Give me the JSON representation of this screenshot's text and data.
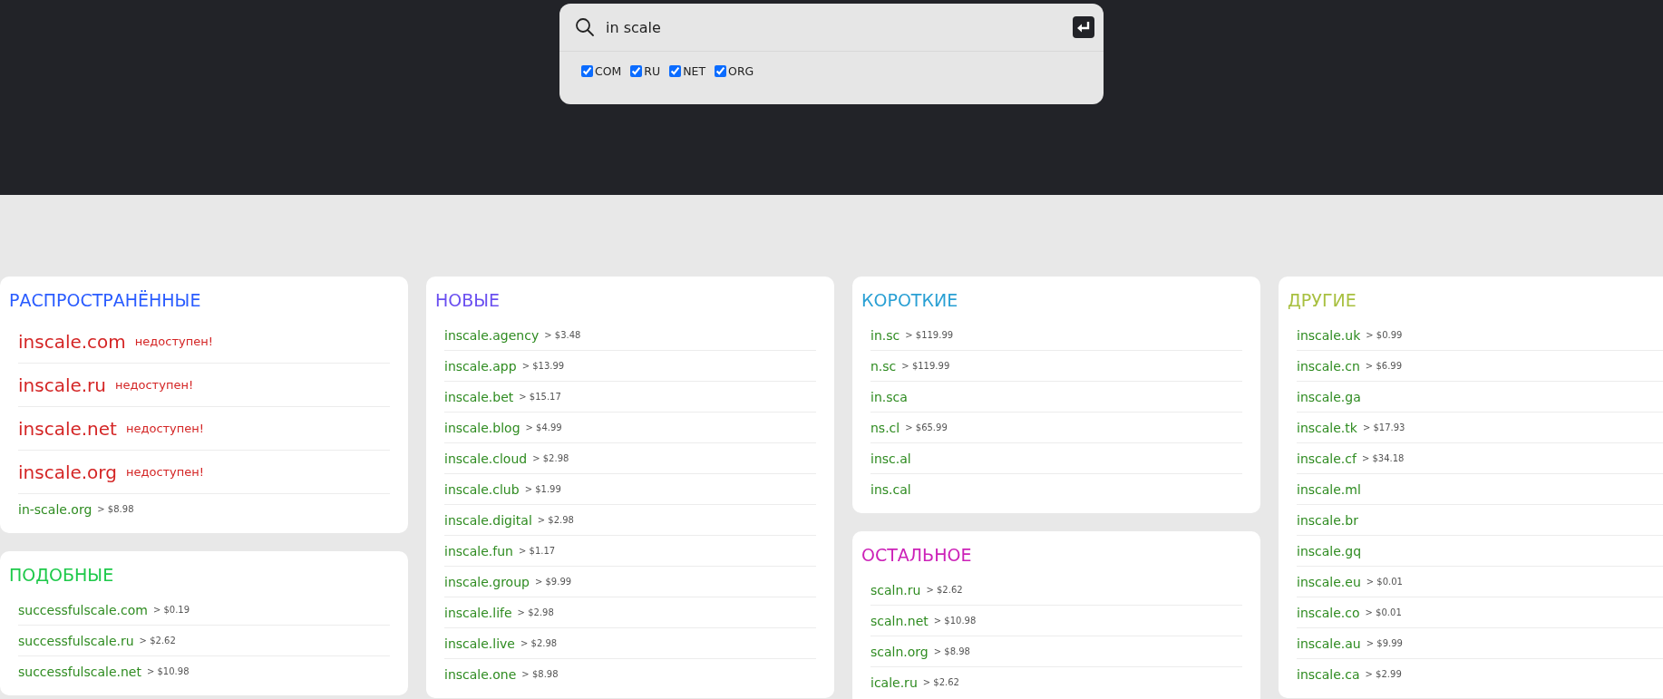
{
  "search": {
    "value": "in scale",
    "filters": [
      {
        "label": "COM",
        "checked": true
      },
      {
        "label": "RU",
        "checked": true
      },
      {
        "label": "NET",
        "checked": true
      },
      {
        "label": "ORG",
        "checked": true
      }
    ]
  },
  "columns": [
    {
      "cards": [
        {
          "title": "РАСПРОСТРАНЁННЫЕ",
          "color": "#2a5cff",
          "items": [
            {
              "kind": "taken",
              "domain": "inscale.com",
              "status": "недоступен!"
            },
            {
              "kind": "taken",
              "domain": "inscale.ru",
              "status": "недоступен!"
            },
            {
              "kind": "taken",
              "domain": "inscale.net",
              "status": "недоступен!"
            },
            {
              "kind": "taken",
              "domain": "inscale.org",
              "status": "недоступен!"
            },
            {
              "kind": "available",
              "domain": "in-scale.org",
              "price": "> $8.98"
            }
          ]
        },
        {
          "title": "ПОДОБНЫЕ",
          "color": "#1ec94a",
          "items": [
            {
              "kind": "available",
              "domain": "successfulscale.com",
              "price": "> $0.19"
            },
            {
              "kind": "available",
              "domain": "successfulscale.ru",
              "price": "> $2.62"
            },
            {
              "kind": "available",
              "domain": "successfulscale.net",
              "price": "> $10.98"
            }
          ]
        }
      ]
    },
    {
      "cards": [
        {
          "title": "НОВЫЕ",
          "color": "#6a4ff0",
          "items": [
            {
              "kind": "available",
              "domain": "inscale.agency",
              "price": "> $3.48"
            },
            {
              "kind": "available",
              "domain": "inscale.app",
              "price": "> $13.99"
            },
            {
              "kind": "available",
              "domain": "inscale.bet",
              "price": "> $15.17"
            },
            {
              "kind": "available",
              "domain": "inscale.blog",
              "price": "> $4.99"
            },
            {
              "kind": "available",
              "domain": "inscale.cloud",
              "price": "> $2.98"
            },
            {
              "kind": "available",
              "domain": "inscale.club",
              "price": "> $1.99"
            },
            {
              "kind": "available",
              "domain": "inscale.digital",
              "price": "> $2.98"
            },
            {
              "kind": "available",
              "domain": "inscale.fun",
              "price": "> $1.17"
            },
            {
              "kind": "available",
              "domain": "inscale.group",
              "price": "> $9.99"
            },
            {
              "kind": "available",
              "domain": "inscale.life",
              "price": "> $2.98"
            },
            {
              "kind": "available",
              "domain": "inscale.live",
              "price": "> $2.98"
            },
            {
              "kind": "available",
              "domain": "inscale.one",
              "price": "> $8.98"
            }
          ]
        }
      ]
    },
    {
      "cards": [
        {
          "title": "КОРОТКИЕ",
          "color": "#2aa0d4",
          "items": [
            {
              "kind": "available",
              "domain": "in.sc",
              "price": "> $119.99"
            },
            {
              "kind": "available",
              "domain": "n.sc",
              "price": "> $119.99"
            },
            {
              "kind": "available",
              "domain": "in.sca"
            },
            {
              "kind": "available",
              "domain": "ns.cl",
              "price": "> $65.99"
            },
            {
              "kind": "available",
              "domain": "insc.al"
            },
            {
              "kind": "available",
              "domain": "ins.cal"
            }
          ]
        },
        {
          "title": "ОСТАЛЬНОЕ",
          "color": "#cc22b8",
          "items": [
            {
              "kind": "available",
              "domain": "scaln.ru",
              "price": "> $2.62"
            },
            {
              "kind": "available",
              "domain": "scaln.net",
              "price": "> $10.98"
            },
            {
              "kind": "available",
              "domain": "scaln.org",
              "price": "> $8.98"
            },
            {
              "kind": "available",
              "domain": "icale.ru",
              "price": "> $2.62"
            }
          ]
        }
      ]
    },
    {
      "cards": [
        {
          "title": "ДРУГИЕ",
          "color": "#a8c040",
          "items": [
            {
              "kind": "available",
              "domain": "inscale.uk",
              "price": "> $0.99"
            },
            {
              "kind": "available",
              "domain": "inscale.cn",
              "price": "> $6.99"
            },
            {
              "kind": "available",
              "domain": "inscale.ga"
            },
            {
              "kind": "available",
              "domain": "inscale.tk",
              "price": "> $17.93"
            },
            {
              "kind": "available",
              "domain": "inscale.cf",
              "price": "> $34.18"
            },
            {
              "kind": "available",
              "domain": "inscale.ml"
            },
            {
              "kind": "available",
              "domain": "inscale.br"
            },
            {
              "kind": "available",
              "domain": "inscale.gq"
            },
            {
              "kind": "available",
              "domain": "inscale.eu",
              "price": "> $0.01"
            },
            {
              "kind": "available",
              "domain": "inscale.co",
              "price": "> $0.01"
            },
            {
              "kind": "available",
              "domain": "inscale.au",
              "price": "> $9.99"
            },
            {
              "kind": "available",
              "domain": "inscale.ca",
              "price": "> $2.99"
            }
          ]
        }
      ]
    }
  ]
}
